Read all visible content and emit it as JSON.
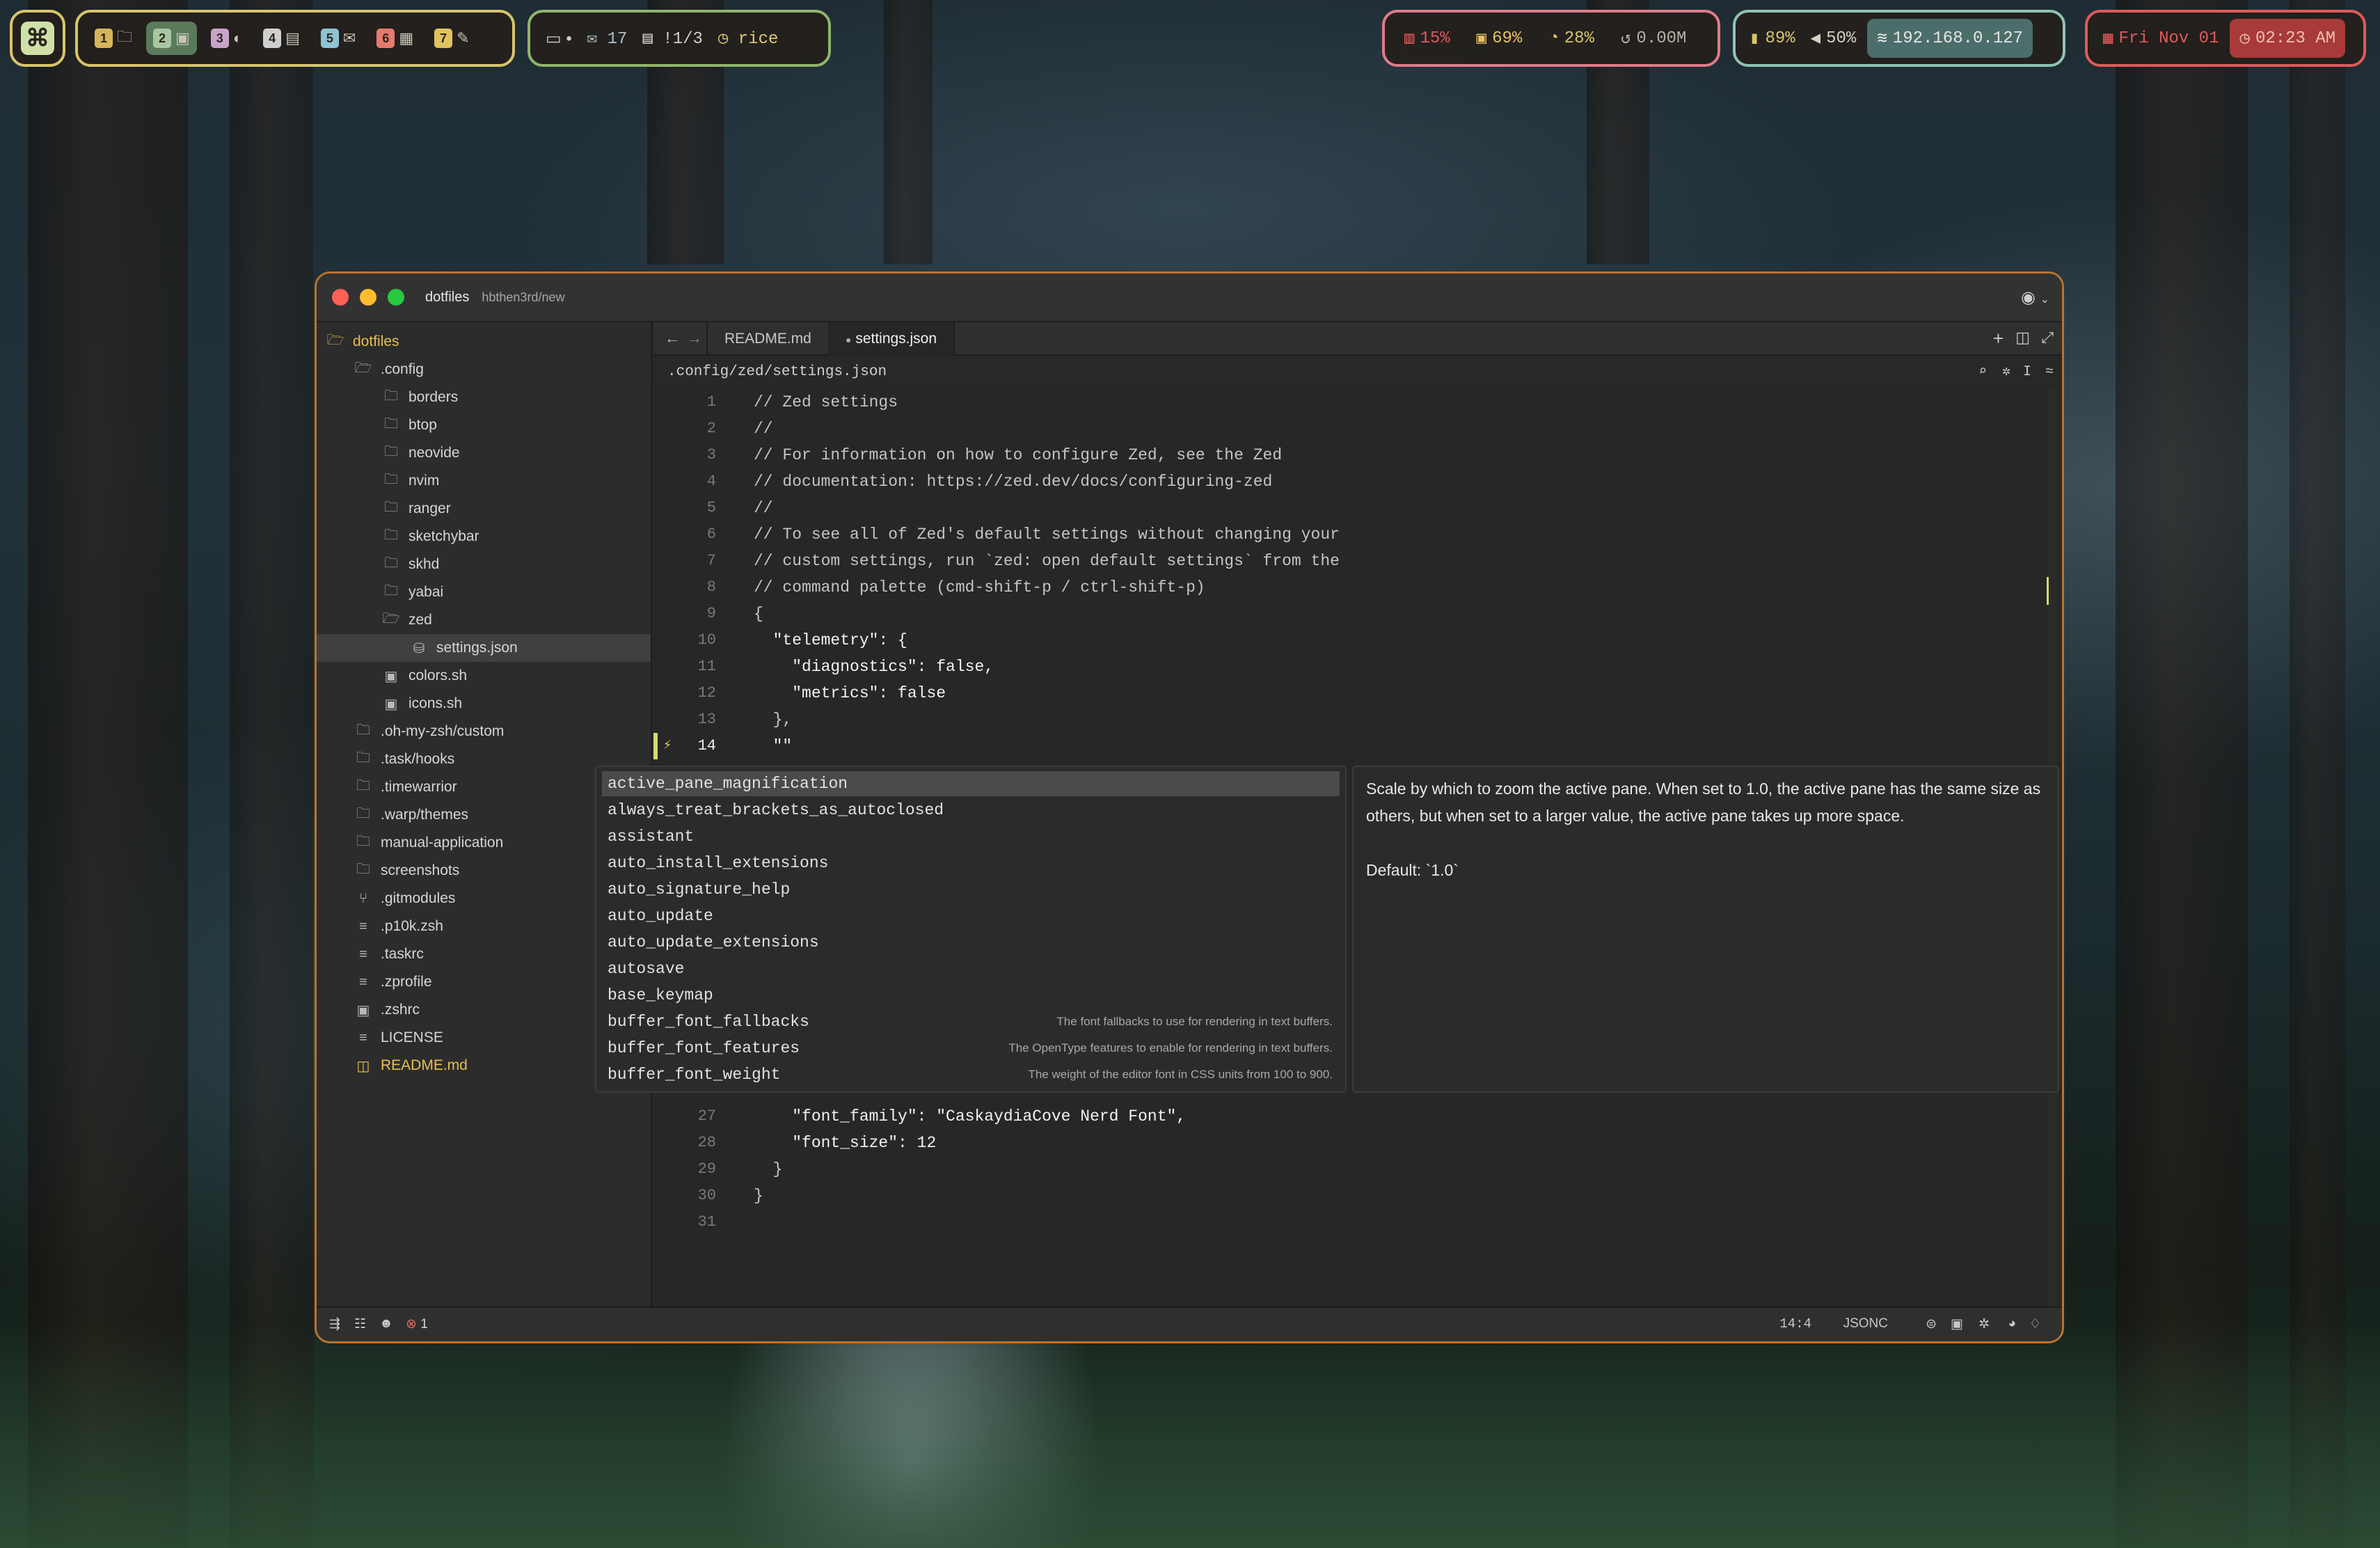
{
  "menubar": {
    "workspaces": [
      {
        "num": "1",
        "icon": "folder-icon",
        "glyph": "🗀",
        "active": false,
        "color": "#d8b45a"
      },
      {
        "num": "2",
        "icon": "terminal-icon",
        "glyph": "▣",
        "active": true,
        "color": "#a8c7a0"
      },
      {
        "num": "3",
        "icon": "browser-icon",
        "glyph": "◐",
        "active": false,
        "color": "#c9a3c9"
      },
      {
        "num": "4",
        "icon": "chat-icon",
        "glyph": "▤",
        "active": false,
        "color": "#cfcfcf"
      },
      {
        "num": "5",
        "icon": "mail-icon",
        "glyph": "✉",
        "active": false,
        "color": "#8fc3d1"
      },
      {
        "num": "6",
        "icon": "calendar-icon",
        "glyph": "▦",
        "active": false,
        "color": "#e57a6d"
      },
      {
        "num": "7",
        "icon": "note-icon",
        "glyph": "✎",
        "active": false,
        "color": "#e0c35e"
      }
    ],
    "notify": {
      "messages_glyph": "▪",
      "dot": "•",
      "mail_count": "17",
      "tasks": "!1/3",
      "timer": "rice"
    },
    "system": {
      "cpu": "15%",
      "memory": "69%",
      "disk": "28%",
      "net": "0.00M"
    },
    "device": {
      "battery": "89%",
      "volume": "50%",
      "ip": "192.168.0.127"
    },
    "clock": {
      "date": "Fri Nov 01",
      "time": "02:23 AM"
    },
    "colors": {
      "accent_yellow": "#d8c56a",
      "accent_green": "#8fb56a",
      "accent_pink": "#e07a8a",
      "accent_red": "#e05a5a"
    }
  },
  "window": {
    "project": "dotfiles",
    "branch": "hbthen3rd/new",
    "tabs": [
      {
        "label": "README.md",
        "active": false
      },
      {
        "label": "settings.json",
        "active": true
      }
    ],
    "breadcrumb": ".config/zed/settings.json",
    "status": {
      "errors": "1",
      "cursor": "14:4",
      "language": "JSONC"
    }
  },
  "tree": [
    {
      "label": "dotfiles",
      "depth": 0,
      "icon": "folder-open-icon",
      "glyph": "🗁",
      "highlight": true
    },
    {
      "label": ".config",
      "depth": 1,
      "icon": "folder-open-icon",
      "glyph": "🗁"
    },
    {
      "label": "borders",
      "depth": 2,
      "icon": "folder-icon",
      "glyph": "🗀"
    },
    {
      "label": "btop",
      "depth": 2,
      "icon": "folder-icon",
      "glyph": "🗀"
    },
    {
      "label": "neovide",
      "depth": 2,
      "icon": "folder-icon",
      "glyph": "🗀"
    },
    {
      "label": "nvim",
      "depth": 2,
      "icon": "folder-icon",
      "glyph": "🗀"
    },
    {
      "label": "ranger",
      "depth": 2,
      "icon": "folder-icon",
      "glyph": "🗀"
    },
    {
      "label": "sketchybar",
      "depth": 2,
      "icon": "folder-icon",
      "glyph": "🗀"
    },
    {
      "label": "skhd",
      "depth": 2,
      "icon": "folder-icon",
      "glyph": "🗀"
    },
    {
      "label": "yabai",
      "depth": 2,
      "icon": "folder-icon",
      "glyph": "🗀"
    },
    {
      "label": "zed",
      "depth": 2,
      "icon": "folder-open-icon",
      "glyph": "🗁"
    },
    {
      "label": "settings.json",
      "depth": 3,
      "icon": "json-file-icon",
      "glyph": "⛁",
      "selected": true
    },
    {
      "label": "colors.sh",
      "depth": 2,
      "icon": "shell-file-icon",
      "glyph": "▣"
    },
    {
      "label": "icons.sh",
      "depth": 2,
      "icon": "shell-file-icon",
      "glyph": "▣"
    },
    {
      "label": ".oh-my-zsh/custom",
      "depth": 1,
      "icon": "folder-icon",
      "glyph": "🗀"
    },
    {
      "label": ".task/hooks",
      "depth": 1,
      "icon": "folder-icon",
      "glyph": "🗀"
    },
    {
      "label": ".timewarrior",
      "depth": 1,
      "icon": "folder-icon",
      "glyph": "🗀"
    },
    {
      "label": ".warp/themes",
      "depth": 1,
      "icon": "folder-icon",
      "glyph": "🗀"
    },
    {
      "label": "manual-application",
      "depth": 1,
      "icon": "folder-icon",
      "glyph": "🗀"
    },
    {
      "label": "screenshots",
      "depth": 1,
      "icon": "folder-icon",
      "glyph": "🗀"
    },
    {
      "label": ".gitmodules",
      "depth": 1,
      "icon": "git-icon",
      "glyph": "⑂"
    },
    {
      "label": ".p10k.zsh",
      "depth": 1,
      "icon": "text-file-icon",
      "glyph": "≡"
    },
    {
      "label": ".taskrc",
      "depth": 1,
      "icon": "text-file-icon",
      "glyph": "≡"
    },
    {
      "label": ".zprofile",
      "depth": 1,
      "icon": "text-file-icon",
      "glyph": "≡"
    },
    {
      "label": ".zshrc",
      "depth": 1,
      "icon": "shell-file-icon",
      "glyph": "▣"
    },
    {
      "label": "LICENSE",
      "depth": 1,
      "icon": "text-file-icon",
      "glyph": "≡"
    },
    {
      "label": "README.md",
      "depth": 1,
      "icon": "markdown-file-icon",
      "glyph": "◫",
      "highlight": true
    }
  ],
  "code": [
    {
      "n": "1",
      "t": "// Zed settings",
      "cls": "cm"
    },
    {
      "n": "2",
      "t": "//",
      "cls": "cm"
    },
    {
      "n": "3",
      "t": "// For information on how to configure Zed, see the Zed",
      "cls": "cm"
    },
    {
      "n": "4",
      "t": "// documentation: https://zed.dev/docs/configuring-zed",
      "cls": "cm"
    },
    {
      "n": "5",
      "t": "//",
      "cls": "cm"
    },
    {
      "n": "6",
      "t": "// To see all of Zed's default settings without changing your",
      "cls": "cm"
    },
    {
      "n": "7",
      "t": "// custom settings, run `zed: open default settings` from the",
      "cls": "cm"
    },
    {
      "n": "8",
      "t": "// command palette (cmd-shift-p / ctrl-shift-p)",
      "cls": "cm"
    },
    {
      "n": "9",
      "t": "{",
      "cls": "pu"
    },
    {
      "n": "10",
      "t": "  \"telemetry\": {",
      "cls": "ky"
    },
    {
      "n": "11",
      "t": "    \"diagnostics\": false,",
      "cls": "ky"
    },
    {
      "n": "12",
      "t": "    \"metrics\": false",
      "cls": "ky"
    },
    {
      "n": "13",
      "t": "  },",
      "cls": "pu"
    },
    {
      "n": "14",
      "t": "  \"\"",
      "cls": "ky"
    }
  ],
  "code_tail": [
    {
      "n": "27",
      "t": "    \"font_family\": \"CaskaydiaCove Nerd Font\",",
      "cls": "ky"
    },
    {
      "n": "28",
      "t": "    \"font_size\": 12",
      "cls": "ky"
    },
    {
      "n": "29",
      "t": "  }",
      "cls": "pu"
    },
    {
      "n": "30",
      "t": "}",
      "cls": "pu"
    },
    {
      "n": "31",
      "t": "",
      "cls": "pu"
    }
  ],
  "completions": [
    {
      "label": "active_pane_magnification",
      "desc": "",
      "selected": true
    },
    {
      "label": "always_treat_brackets_as_autoclosed",
      "desc": ""
    },
    {
      "label": "assistant",
      "desc": ""
    },
    {
      "label": "auto_install_extensions",
      "desc": ""
    },
    {
      "label": "auto_signature_help",
      "desc": ""
    },
    {
      "label": "auto_update",
      "desc": ""
    },
    {
      "label": "auto_update_extensions",
      "desc": ""
    },
    {
      "label": "autosave",
      "desc": ""
    },
    {
      "label": "base_keymap",
      "desc": ""
    },
    {
      "label": "buffer_font_fallbacks",
      "desc": "The font fallbacks to use for rendering in text buffers."
    },
    {
      "label": "buffer_font_features",
      "desc": "The OpenType features to enable for rendering in text buffers."
    },
    {
      "label": "buffer_font_weight",
      "desc": "The weight of the editor font in CSS units from 100 to 900."
    }
  ],
  "doc": {
    "text": "Scale by which to zoom the active pane. When set to 1.0, the active pane has the same size as others, but when set to a larger value, the active pane takes up more space.",
    "default": "Default: `1.0`"
  }
}
